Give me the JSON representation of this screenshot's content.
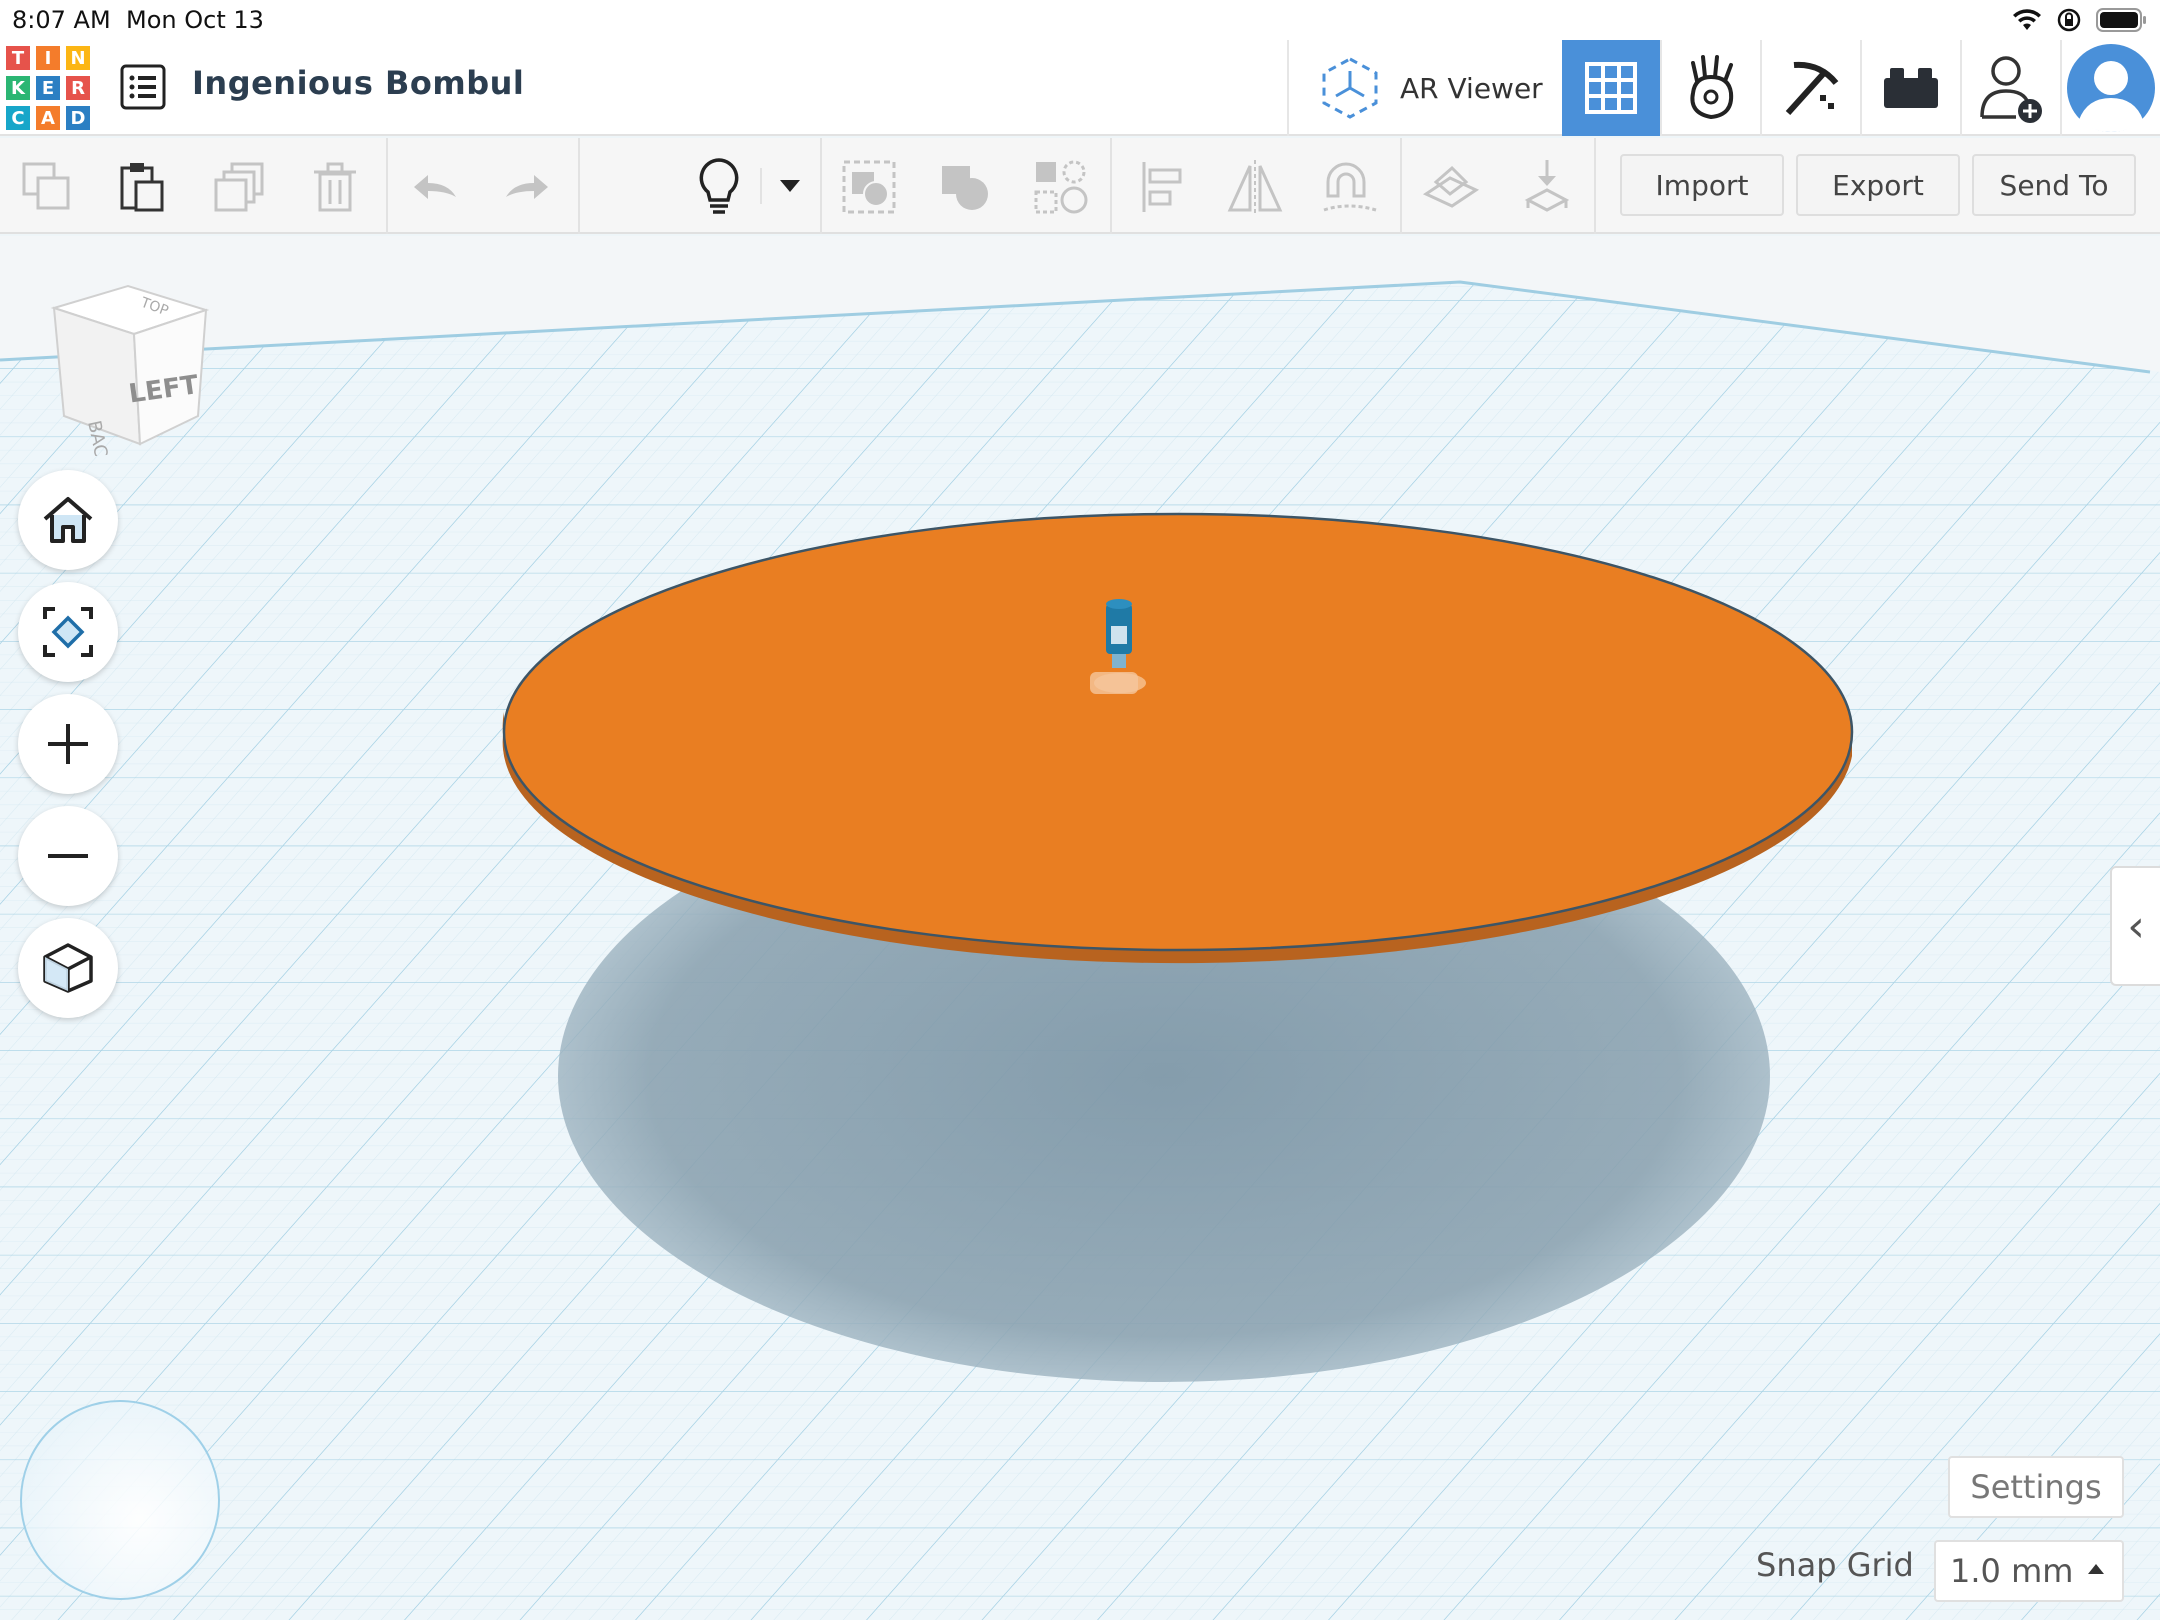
{
  "status_bar": {
    "time": "8:07 AM",
    "date": "Mon Oct 13"
  },
  "header": {
    "logo_letters": [
      "T",
      "I",
      "N",
      "K",
      "E",
      "R",
      "C",
      "A",
      "D"
    ],
    "design_title": "Ingenious Bombul",
    "ar_viewer_label": "AR Viewer",
    "buttons": [
      "3d-design-grid",
      "codeblocks-hand",
      "minecraft-pickaxe",
      "lego-brick",
      "invite-user",
      "user-avatar"
    ],
    "active_color": "#4a90d9"
  },
  "toolbar": {
    "icons": [
      "copy",
      "paste",
      "duplicate",
      "delete",
      "undo",
      "redo",
      "notes-lightbulb",
      "dropdown",
      "group",
      "ungroup",
      "align-holes",
      "align",
      "mirror",
      "cruise",
      "workplane",
      "drop"
    ],
    "import_label": "Import",
    "export_label": "Export",
    "send_to_label": "Send To"
  },
  "view_cube": {
    "face_label": "LEFT"
  },
  "left_controls": [
    "home-view",
    "fit-view",
    "zoom-in",
    "zoom-out",
    "projection-toggle"
  ],
  "scene": {
    "shape": "cylinder",
    "shape_color": "#e97e22",
    "small_object_color": "#1f7aa6",
    "shadow_color": "#7f98a8"
  },
  "bottom_right": {
    "settings_label": "Settings",
    "snap_grid_label": "Snap Grid",
    "snap_grid_value": "1.0 mm"
  },
  "side_panel_toggle": "‹"
}
